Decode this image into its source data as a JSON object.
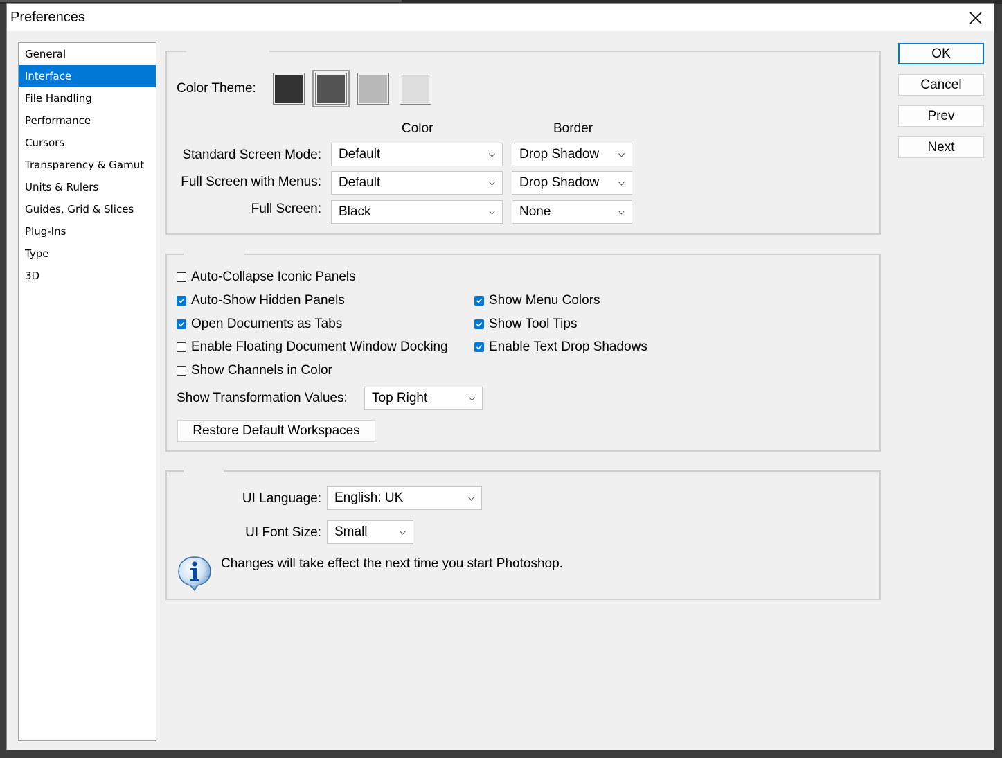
{
  "window": {
    "title": "Preferences"
  },
  "sidebar": {
    "items": [
      {
        "label": "General"
      },
      {
        "label": "Interface",
        "selected": true
      },
      {
        "label": "File Handling"
      },
      {
        "label": "Performance"
      },
      {
        "label": "Cursors"
      },
      {
        "label": "Transparency & Gamut"
      },
      {
        "label": "Units & Rulers"
      },
      {
        "label": "Guides, Grid & Slices"
      },
      {
        "label": "Plug-Ins"
      },
      {
        "label": "Type"
      },
      {
        "label": "3D"
      }
    ]
  },
  "appearance": {
    "color_theme_label": "Color Theme:",
    "themes": [
      {
        "color": "#333333"
      },
      {
        "color": "#535353",
        "selected": true
      },
      {
        "color": "#b8b8b8"
      },
      {
        "color": "#dedede"
      }
    ],
    "color_header": "Color",
    "border_header": "Border",
    "standard_label": "Standard Screen Mode:",
    "standard_color": "Default",
    "standard_border": "Drop Shadow",
    "fullmenus_label": "Full Screen with Menus:",
    "fullmenus_color": "Default",
    "fullmenus_border": "Drop Shadow",
    "full_label": "Full Screen:",
    "full_color": "Black",
    "full_border": "None"
  },
  "options": {
    "auto_collapse": {
      "label": "Auto-Collapse Iconic Panels",
      "checked": false
    },
    "auto_show": {
      "label": "Auto-Show Hidden Panels",
      "checked": true
    },
    "open_tabs": {
      "label": "Open Documents as Tabs",
      "checked": true
    },
    "floating_docking": {
      "label": "Enable Floating Document Window Docking",
      "checked": false
    },
    "channels_color": {
      "label": "Show Channels in Color",
      "checked": false
    },
    "menu_colors": {
      "label": "Show Menu Colors",
      "checked": true
    },
    "tool_tips": {
      "label": "Show Tool Tips",
      "checked": true
    },
    "text_shadows": {
      "label": "Enable Text Drop Shadows",
      "checked": true
    },
    "transform_label": "Show Transformation Values:",
    "transform_value": "Top Right",
    "restore_button": "Restore Default Workspaces"
  },
  "text": {
    "language_label": "UI Language:",
    "language_value": "English: UK",
    "font_size_label": "UI Font Size:",
    "font_size_value": "Small",
    "notice": "Changes will take effect the next time you start Photoshop."
  },
  "buttons": {
    "ok": "OK",
    "cancel": "Cancel",
    "prev": "Prev",
    "next": "Next"
  },
  "colors": {
    "accent": "#0078d7",
    "dialog_bg": "#f0f0f0"
  }
}
